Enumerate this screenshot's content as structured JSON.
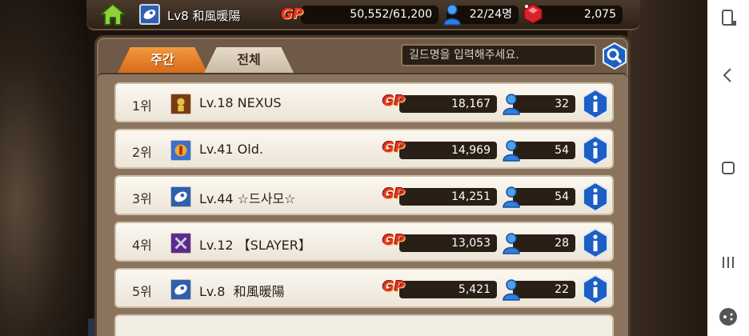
{
  "topbar": {
    "guild_name": "Lv8 和風暖陽",
    "gp_label": "GP",
    "gp_value": "50,552/61,200",
    "members": "22/24명",
    "gems": "2,075"
  },
  "tabs": [
    {
      "label": "주간",
      "active": true
    },
    {
      "label": "전체",
      "active": false
    }
  ],
  "search": {
    "placeholder": "길드명을 입력해주세요."
  },
  "rows": [
    {
      "rank": "1위",
      "name": "Lv.18 NEXUS",
      "gp_label": "GP",
      "gp": "18,167",
      "members": "32",
      "emblem_color": "#7a3a12",
      "emblem_accent": "#e8c040"
    },
    {
      "rank": "2위",
      "name": "Lv.41 Old.",
      "gp_label": "GP",
      "gp": "14,969",
      "members": "54",
      "emblem_color": "#3a6fd0",
      "emblem_accent": "#e8b020"
    },
    {
      "rank": "3위",
      "name": "Lv.44 ☆드사모☆",
      "gp_label": "GP",
      "gp": "14,251",
      "members": "54",
      "emblem_color": "#2f5fb0",
      "emblem_accent": "#ffffff"
    },
    {
      "rank": "4위",
      "name": "Lv.12 【SLAYER】",
      "gp_label": "GP",
      "gp": "13,053",
      "members": "28",
      "emblem_color": "#5a2a90",
      "emblem_accent": "#d0d0e0"
    },
    {
      "rank": "5위",
      "name": "Lv.8  和風暖陽",
      "gp_label": "GP",
      "gp": "5,421",
      "members": "22",
      "emblem_color": "#2f5fb0",
      "emblem_accent": "#ffffff"
    }
  ],
  "colors": {
    "gp_red": "#e8352a",
    "info_blue": "#1d5ec4",
    "tab_orange": "#e8822e",
    "user_blue": "#2e7fe0"
  },
  "icons": {
    "home": "home-icon",
    "search": "search-icon",
    "info": "info-icon",
    "user": "user-icon",
    "gem": "gem-icon"
  }
}
